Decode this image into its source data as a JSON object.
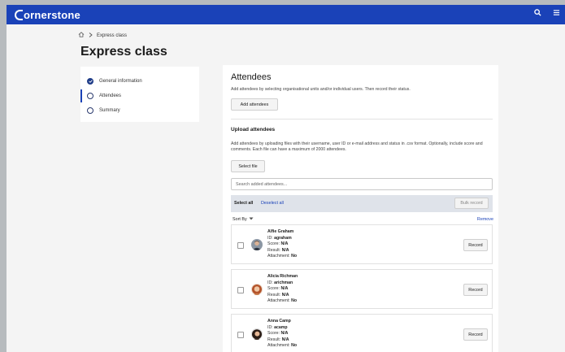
{
  "app": {
    "logo": "ornerstone"
  },
  "breadcrumb": {
    "current": "Express class"
  },
  "page": {
    "title": "Express class"
  },
  "steps": [
    {
      "label": "General information",
      "state": "done"
    },
    {
      "label": "Attendees",
      "state": "active"
    },
    {
      "label": "Summary",
      "state": "pending"
    }
  ],
  "attendees": {
    "title": "Attendees",
    "description": "Add attendees by selecting organisational units and/or individual users. Then record their status.",
    "add_button": "Add attendees"
  },
  "upload": {
    "title": "Upload attendees",
    "description": "Add attendees by uploading files with their username, user ID or e-mail address and status in .csv format. Optionally, include score and comments. Each file can have a maximum of 2000 attendees.",
    "select_file": "Select file"
  },
  "search": {
    "placeholder": "Search added attendees..."
  },
  "selection": {
    "select_all": "Select all",
    "deselect_all": "Deselect all",
    "bulk_record": "Bulk record"
  },
  "list": {
    "sort_by": "Sort By",
    "remove": "Remove"
  },
  "labels": {
    "id": "ID:",
    "score": "Score:",
    "result": "Result:",
    "attachment": "Attachment:"
  },
  "people": [
    {
      "name": "Alfie Graham",
      "id": "agraham",
      "score": "N/A",
      "result": "N/A",
      "attachment": "No",
      "record": "Record"
    },
    {
      "name": "Alicia Richman",
      "id": "arichman",
      "score": "N/A",
      "result": "N/A",
      "attachment": "No",
      "record": "Record"
    },
    {
      "name": "Anna Camp",
      "id": "acamp",
      "score": "N/A",
      "result": "N/A",
      "attachment": "No",
      "record": "Record"
    }
  ],
  "colors": {
    "brand": "#1a42b8",
    "link": "#1a42b8"
  },
  "icons": [
    "search-icon",
    "menu-icon",
    "home-icon",
    "chevron-right-icon",
    "check-icon",
    "caret-down-icon"
  ]
}
